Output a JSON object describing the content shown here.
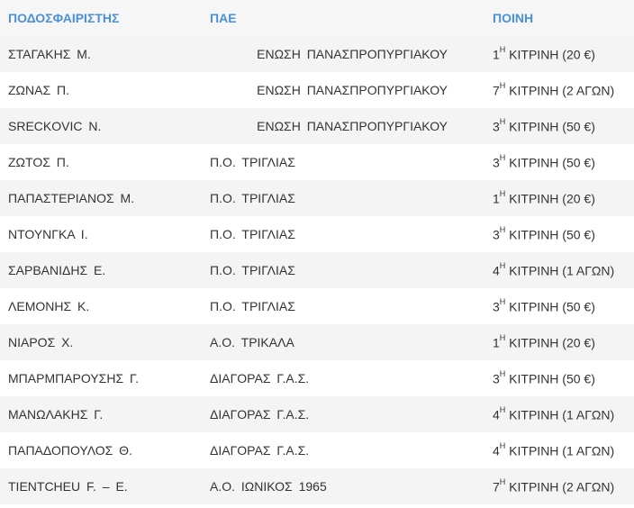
{
  "header": {
    "player": "ΠΟΔΟΣΦΑΙΡΙΣΤΗΣ",
    "club": "ΠΑΕ",
    "penalty": "ΠΟΙΝΗ"
  },
  "rows": [
    {
      "player": "ΣΤΑΓΑΚΗΣ Μ.",
      "club": "ΕΝΩΣΗ ΠΑΝΑΣΠΡΟΠΥΡΓΙΑΚΟΥ",
      "num": "1",
      "sup": "Η",
      "penalty": " ΚΙΤΡΙΝΗ (20 €)"
    },
    {
      "player": "ΖΩΝΑΣ Π.",
      "club": "ΕΝΩΣΗ ΠΑΝΑΣΠΡΟΠΥΡΓΙΑΚΟΥ",
      "num": "7",
      "sup": "Η",
      "penalty": " ΚΙΤΡΙΝΗ (2 ΑΓΩΝ)"
    },
    {
      "player": "SRECKOVIC Ν.",
      "club": "ΕΝΩΣΗ ΠΑΝΑΣΠΡΟΠΥΡΓΙΑΚΟΥ",
      "num": "3",
      "sup": "Η",
      "penalty": " ΚΙΤΡΙΝΗ (50 €)"
    },
    {
      "player": "ΖΩΤΟΣ Π.",
      "club": "Π.Ο. ΤΡΙΓΛΙΑΣ",
      "num": "3",
      "sup": "Η",
      "penalty": " ΚΙΤΡΙΝΗ (50 €)"
    },
    {
      "player": "ΠΑΠΑΣΤΕΡΙΑΝΟΣ Μ.",
      "club": "Π.Ο. ΤΡΙΓΛΙΑΣ",
      "num": "1",
      "sup": "Η",
      "penalty": " ΚΙΤΡΙΝΗ (20 €)"
    },
    {
      "player": "ΝΤΟΥΝΓΚΑ Ι.",
      "club": "Π.Ο. ΤΡΙΓΛΙΑΣ",
      "num": "3",
      "sup": "Η",
      "penalty": " ΚΙΤΡΙΝΗ (50 €)"
    },
    {
      "player": "ΣΑΡΒΑΝΙΔΗΣ Ε.",
      "club": "Π.Ο. ΤΡΙΓΛΙΑΣ",
      "num": "4",
      "sup": "Η",
      "penalty": " ΚΙΤΡΙΝΗ (1 ΑΓΩΝ)"
    },
    {
      "player": "ΛΕΜΟΝΗΣ Κ.",
      "club": "Π.Ο. ΤΡΙΓΛΙΑΣ",
      "num": "3",
      "sup": "Η",
      "penalty": " ΚΙΤΡΙΝΗ (50 €)"
    },
    {
      "player": "ΝΙΑΡΟΣ Χ.",
      "club": "Α.Ο. ΤΡΙΚΑΛΑ",
      "num": "1",
      "sup": "Η",
      "penalty": " ΚΙΤΡΙΝΗ (20 €)"
    },
    {
      "player": "ΜΠΑΡΜΠΑΡΟΥΣΗΣ Γ.",
      "club": "ΔΙΑΓΟΡΑΣ Γ.Α.Σ.",
      "num": "3",
      "sup": "Η",
      "penalty": " ΚΙΤΡΙΝΗ (50 €)"
    },
    {
      "player": "ΜΑΝΩΛΑΚΗΣ Γ.",
      "club": "ΔΙΑΓΟΡΑΣ Γ.Α.Σ.",
      "num": "4",
      "sup": "Η",
      "penalty": " ΚΙΤΡΙΝΗ (1 ΑΓΩΝ)"
    },
    {
      "player": "ΠΑΠΑΔΟΠΟΥΛΟΣ Θ.",
      "club": "ΔΙΑΓΟΡΑΣ Γ.Α.Σ.",
      "num": "4",
      "sup": "Η",
      "penalty": " ΚΙΤΡΙΝΗ (1 ΑΓΩΝ)"
    },
    {
      "player": "TIENTCHEU F. – Ε.",
      "club": "Α.Ο. ΙΩΝΙΚΟΣ 1965",
      "num": "7",
      "sup": "Η",
      "penalty": " ΚΙΤΡΙΝΗ (2 ΑΓΩΝ)"
    }
  ]
}
